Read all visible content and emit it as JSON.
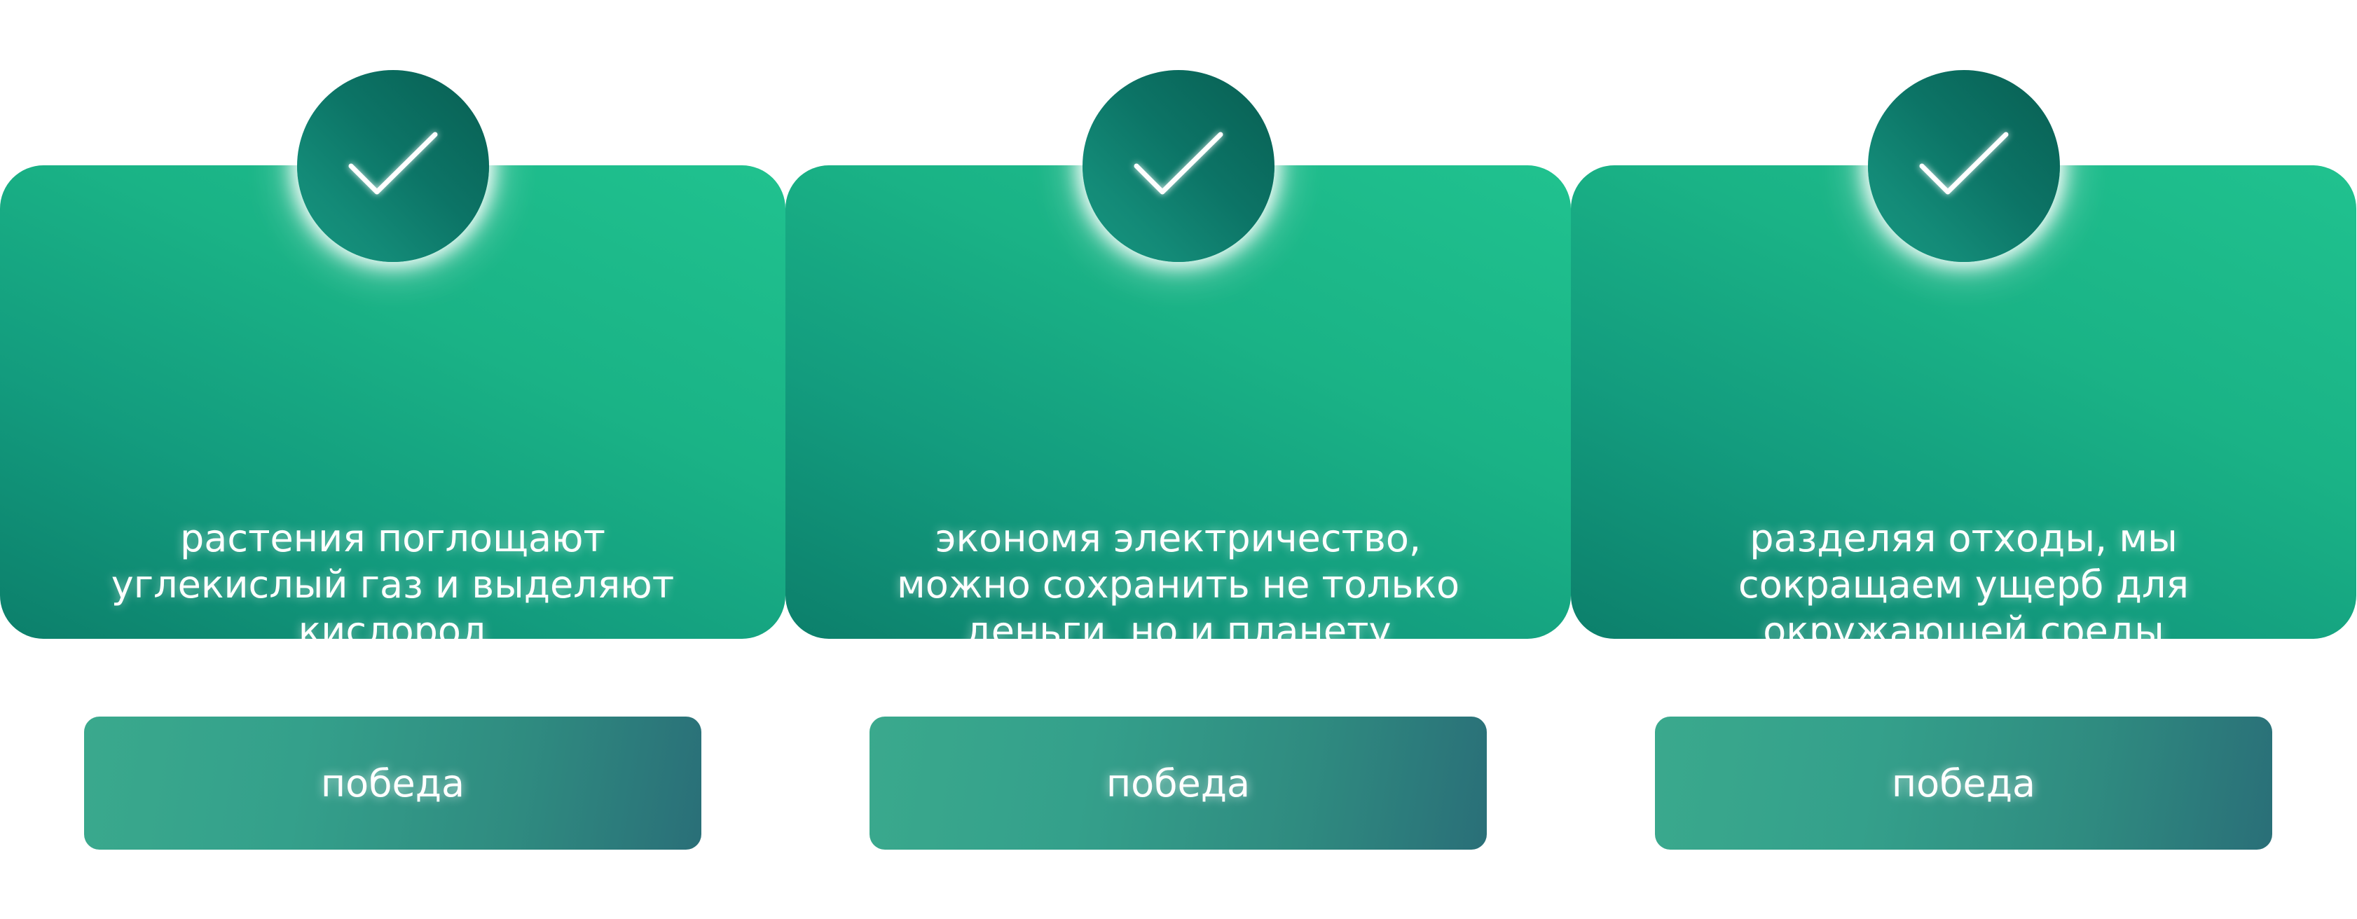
{
  "colors": {
    "card_light": "#20c28f",
    "card_dark": "#0c7f6b",
    "badge_dark": "#085e52",
    "button_left": "#3aa98d",
    "button_right": "#2a6f78",
    "text": "#ffffff"
  },
  "cards": [
    {
      "icon": "checkmark-icon",
      "text_lines": [
        "растения поглощают",
        "углекислый газ и выделяют",
        "кислород"
      ],
      "button_label": "победа"
    },
    {
      "icon": "checkmark-icon",
      "text_lines": [
        "экономя электричество,",
        "можно сохранить не только",
        "деньги, но и планету"
      ],
      "button_label": "победа"
    },
    {
      "icon": "checkmark-icon",
      "text_lines": [
        "разделяя отходы, мы",
        "сокращаем ущерб для",
        "окружающей среды"
      ],
      "button_label": "победа"
    }
  ]
}
